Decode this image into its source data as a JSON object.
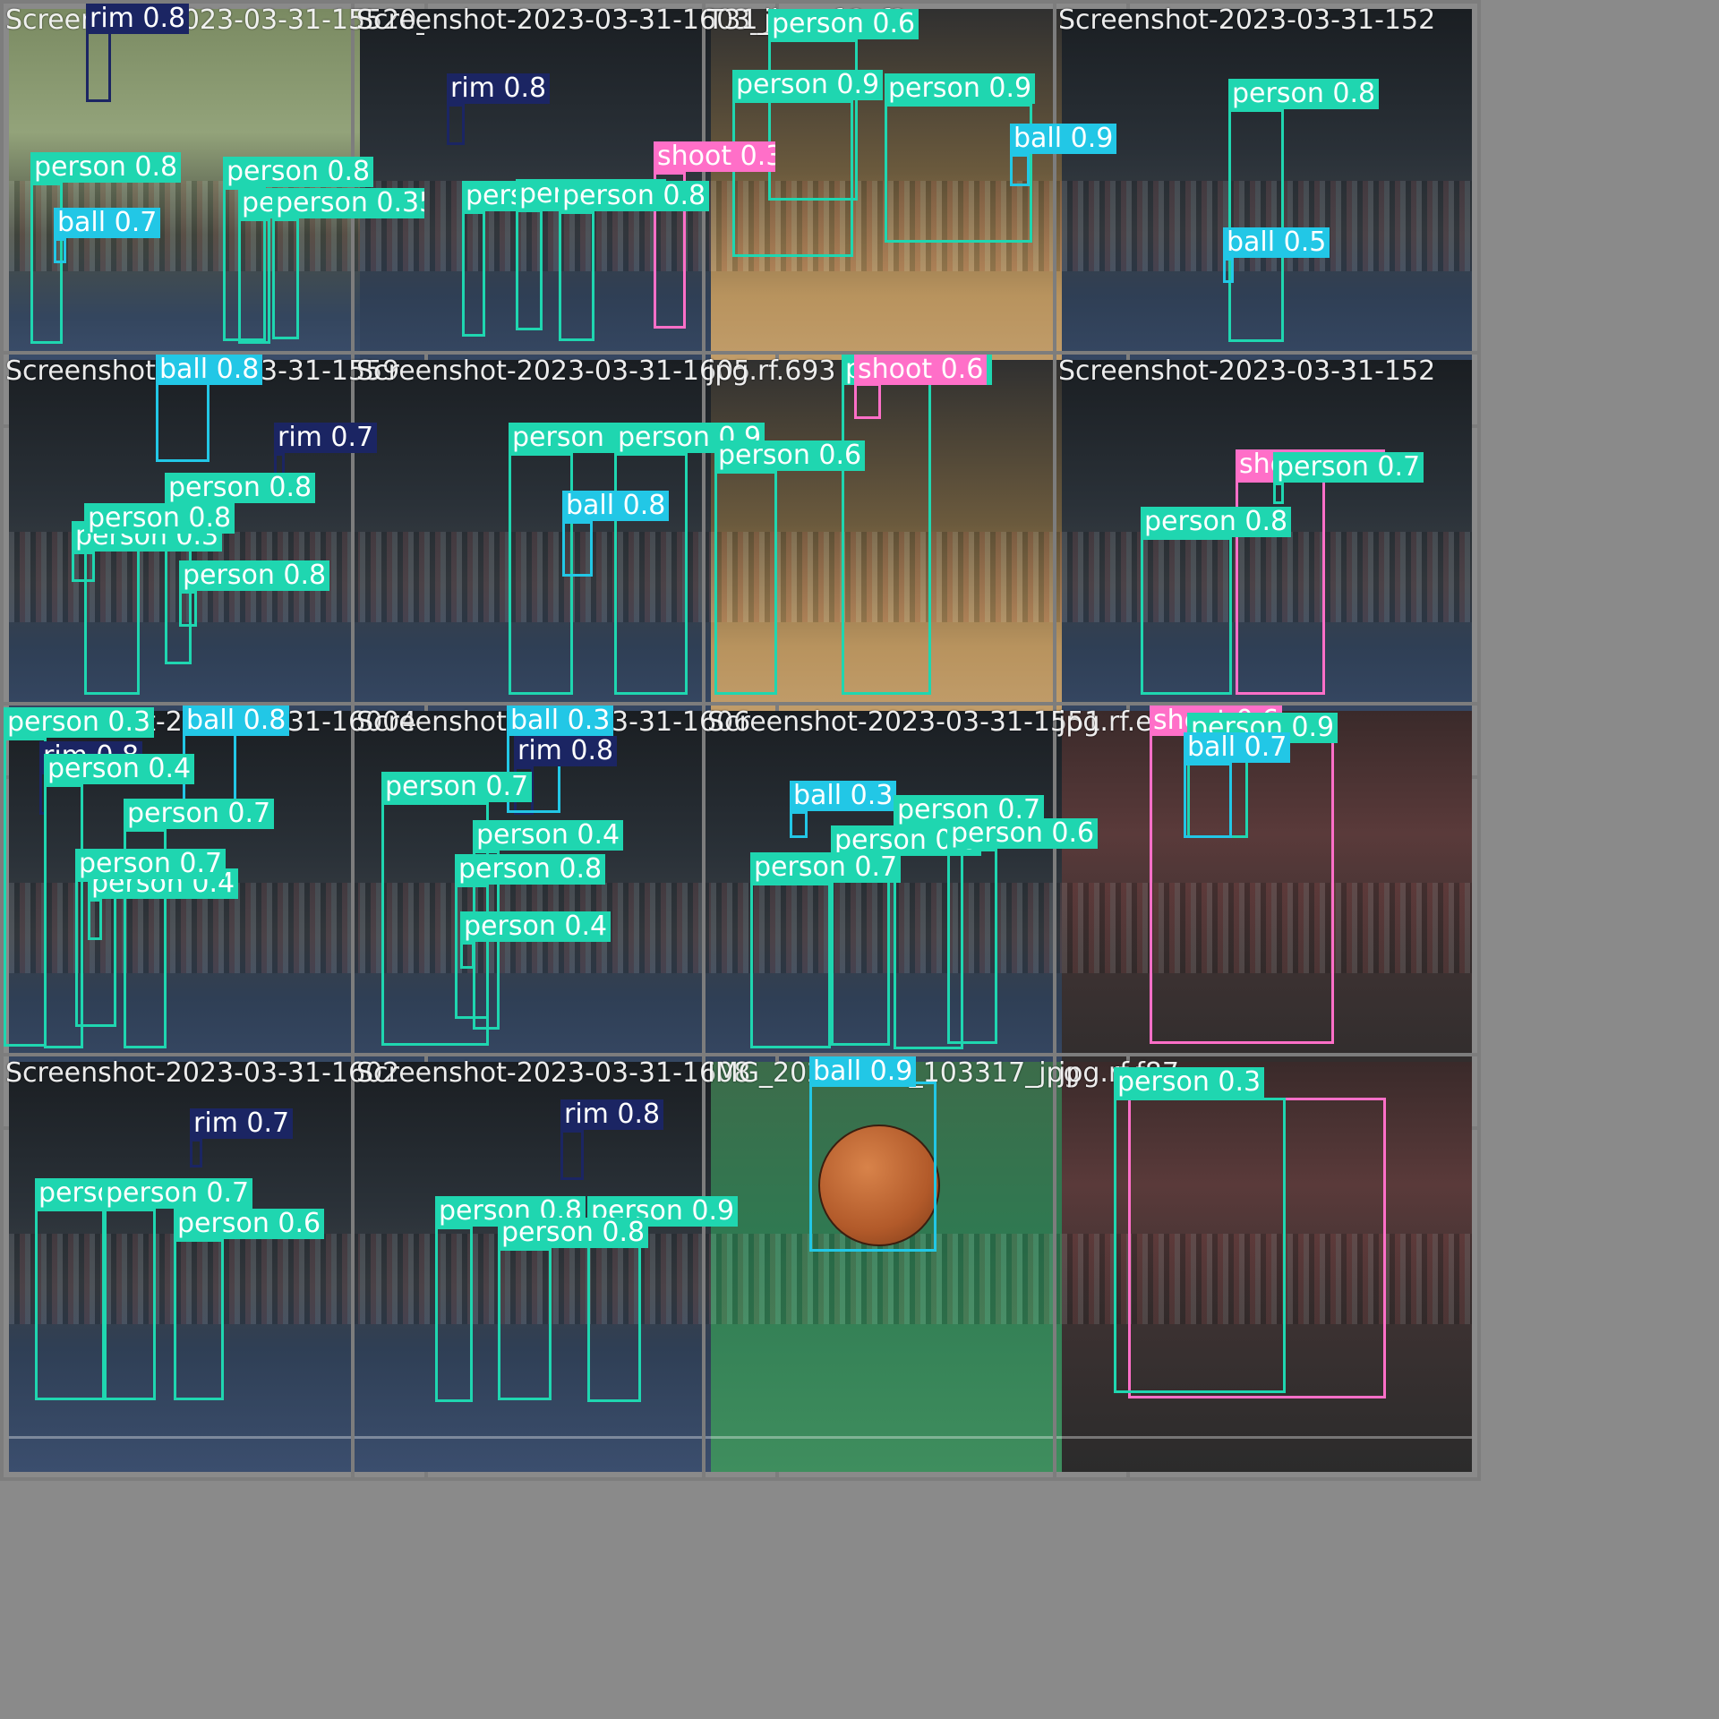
{
  "colors": {
    "person": "#1fd6b0",
    "ball": "#22c7e6",
    "rim": "#1b2563",
    "shoot": "#ff6fc8"
  },
  "tiles": [
    {
      "title": "Screenshot-2023-03-31-15520_jpg.rf",
      "scene": "hall",
      "detections": [
        {
          "label": "rim 0.8",
          "cls": "rim"
        },
        {
          "label": "person 0.8",
          "cls": "person"
        },
        {
          "label": "person 0.8",
          "cls": "person"
        },
        {
          "label": "person 0.3",
          "cls": "person"
        },
        {
          "label": "person 0.35",
          "cls": "person"
        },
        {
          "label": "ball 0.7",
          "cls": "ball"
        }
      ]
    },
    {
      "title": "Screenshot-2023-03-31-1603_jpg.rf",
      "scene": "arena",
      "detections": [
        {
          "label": "rim 0.8",
          "cls": "rim"
        },
        {
          "label": "person 0.8",
          "cls": "person"
        },
        {
          "label": "person 0.7",
          "cls": "person"
        },
        {
          "label": "person 0.8",
          "cls": "person"
        },
        {
          "label": "shoot 0.3",
          "cls": "shoot"
        }
      ]
    },
    {
      "title": "T31_jpg.rf.2cf3",
      "scene": "pro",
      "detections": [
        {
          "label": "person 0.6",
          "cls": "person"
        },
        {
          "label": "person 0.9",
          "cls": "person"
        },
        {
          "label": "person 0.9",
          "cls": "person"
        },
        {
          "label": "ball 0.9",
          "cls": "ball"
        }
      ]
    },
    {
      "title": "Screenshot-2023-03-31-152",
      "scene": "arena",
      "detections": [
        {
          "label": "person 0.8",
          "cls": "person"
        },
        {
          "label": "ball 0.5",
          "cls": "ball"
        }
      ]
    },
    {
      "title": "Screenshot-2023-03-31-1559",
      "scene": "arena",
      "detections": [
        {
          "label": "rim 0.7",
          "cls": "rim"
        },
        {
          "label": "person 0.8",
          "cls": "person"
        },
        {
          "label": "person 0.3",
          "cls": "person"
        },
        {
          "label": "person 0.8",
          "cls": "person"
        },
        {
          "label": "person 0.8",
          "cls": "person"
        },
        {
          "label": "ball 0.8",
          "cls": "ball"
        }
      ]
    },
    {
      "title": "Screenshot-2023-03-31-1605",
      "scene": "arena",
      "detections": [
        {
          "label": "person 0.8",
          "cls": "person"
        },
        {
          "label": "person 0.9",
          "cls": "person"
        },
        {
          "label": "ball 0.8",
          "cls": "ball"
        }
      ]
    },
    {
      "title": "jpg.rf.693",
      "scene": "pro",
      "detections": [
        {
          "label": "person 0.8",
          "cls": "person"
        },
        {
          "label": "shoot 0.6",
          "cls": "shoot"
        },
        {
          "label": "person 0.6",
          "cls": "person"
        }
      ]
    },
    {
      "title": "Screenshot-2023-03-31-152",
      "scene": "arena",
      "detections": [
        {
          "label": "shoot 0.44",
          "cls": "shoot"
        },
        {
          "label": "person 0.7",
          "cls": "person"
        },
        {
          "label": "person 0.8",
          "cls": "person"
        }
      ]
    },
    {
      "title": "Screenshot-2023-03-31-16004",
      "scene": "arena",
      "detections": [
        {
          "label": "person 0.3",
          "cls": "person"
        },
        {
          "label": "rim 0.8",
          "cls": "rim"
        },
        {
          "label": "person 0.4",
          "cls": "person"
        },
        {
          "label": "person 0.4",
          "cls": "person"
        },
        {
          "label": "person 0.7",
          "cls": "person"
        },
        {
          "label": "person 0.7",
          "cls": "person"
        },
        {
          "label": "ball 0.8",
          "cls": "ball"
        }
      ]
    },
    {
      "title": "Screenshot-2023-03-31-1606",
      "scene": "arena",
      "detections": [
        {
          "label": "rim 0.8",
          "cls": "rim"
        },
        {
          "label": "person 0.7",
          "cls": "person"
        },
        {
          "label": "person 0.4",
          "cls": "person"
        },
        {
          "label": "person 0.8",
          "cls": "person"
        },
        {
          "label": "person 0.4",
          "cls": "person"
        },
        {
          "label": "ball 0.3",
          "cls": "ball"
        }
      ]
    },
    {
      "title": "Screenshot-2023-03-31-1551",
      "scene": "arena",
      "detections": [
        {
          "label": "ball 0.3",
          "cls": "ball"
        },
        {
          "label": "person 0.7",
          "cls": "person"
        },
        {
          "label": "person 0.8",
          "cls": "person"
        },
        {
          "label": "person 0.6",
          "cls": "person"
        },
        {
          "label": "person 0.7",
          "cls": "person"
        }
      ]
    },
    {
      "title": "jpg.rf.eb2",
      "scene": "crowd",
      "detections": [
        {
          "label": "shoot 0.6",
          "cls": "shoot"
        },
        {
          "label": "person 0.9",
          "cls": "person"
        },
        {
          "label": "ball 0.7",
          "cls": "ball"
        }
      ]
    },
    {
      "title": "Screenshot-2023-03-31-1602",
      "scene": "arena",
      "detections": [
        {
          "label": "rim 0.7",
          "cls": "rim"
        },
        {
          "label": "person 0.7",
          "cls": "person"
        },
        {
          "label": "person 0.7",
          "cls": "person"
        },
        {
          "label": "person 0.6",
          "cls": "person"
        }
      ]
    },
    {
      "title": "Screenshot-2023-03-31-1608",
      "scene": "arena",
      "detections": [
        {
          "label": "rim 0.8",
          "cls": "rim"
        },
        {
          "label": "person 0.8",
          "cls": "person"
        },
        {
          "label": "person 0.9",
          "cls": "person"
        },
        {
          "label": "person 0.8",
          "cls": "person"
        }
      ]
    },
    {
      "title": "IMG_20201010_103317_jpg",
      "scene": "green",
      "detections": [
        {
          "label": "ball 0.9",
          "cls": "ball"
        }
      ]
    },
    {
      "title": "jpg.rf.f87",
      "scene": "crowd",
      "detections": [
        {
          "label": "shoot 0.3",
          "cls": "shoot"
        },
        {
          "label": "person 0.3",
          "cls": "person"
        }
      ]
    }
  ]
}
